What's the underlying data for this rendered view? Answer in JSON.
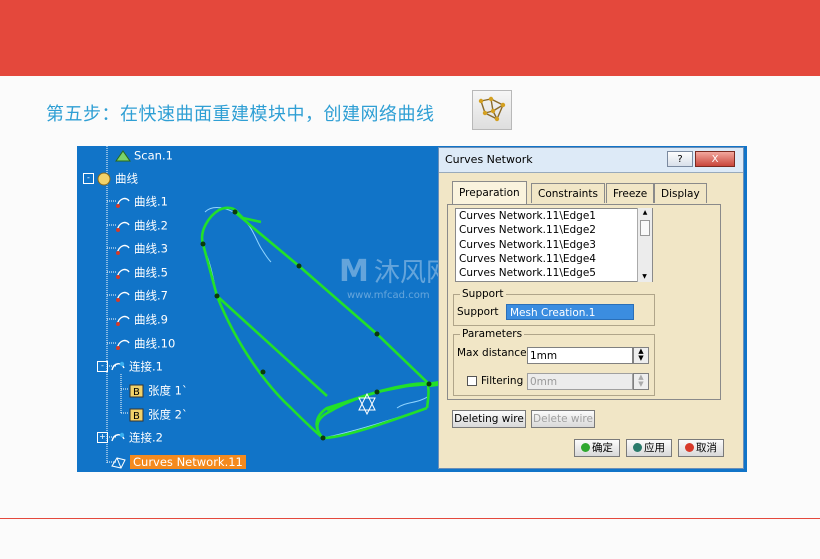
{
  "title": "第五步：在快速曲面重建模块中，创建网络曲线",
  "tree": [
    {
      "label": "Scan.1",
      "icon": "scan-icon"
    },
    {
      "label": "曲线",
      "icon": "geometric-set-icon"
    },
    {
      "label": "曲线.1",
      "icon": "curve-icon"
    },
    {
      "label": "曲线.2",
      "icon": "curve-icon"
    },
    {
      "label": "曲线.3",
      "icon": "curve-icon"
    },
    {
      "label": "曲线.5",
      "icon": "curve-icon"
    },
    {
      "label": "曲线.7",
      "icon": "curve-icon"
    },
    {
      "label": "曲线.9",
      "icon": "curve-icon"
    },
    {
      "label": "曲线.10",
      "icon": "curve-icon"
    },
    {
      "label": "连接.1",
      "icon": "join-icon"
    },
    {
      "label": "张度 1`",
      "icon": "tension-icon"
    },
    {
      "label": "张度 2`",
      "icon": "tension-icon"
    },
    {
      "label": "连接.2",
      "icon": "join-icon"
    },
    {
      "label": "Curves Network.11",
      "icon": "curves-network-icon"
    }
  ],
  "dialog": {
    "title": "Curves Network",
    "help": "?",
    "close": "X",
    "tabs": [
      "Preparation",
      "Constraints",
      "Freeze",
      "Display"
    ],
    "edges": [
      "Curves Network.11\\Edge1",
      "Curves Network.11\\Edge2",
      "Curves Network.11\\Edge3",
      "Curves Network.11\\Edge4",
      "Curves Network.11\\Edge5"
    ],
    "support_group": "Support",
    "support_label": "Support",
    "support_value": "Mesh Creation.1",
    "params_group": "Parameters",
    "max_distance_label": "Max distance",
    "max_distance_value": "1mm",
    "filtering_label": "Filtering",
    "filtering_value": "0mm",
    "deleting_wire": "Deleting wire",
    "delete_wire": "Delete wire",
    "ok": "确定",
    "apply": "应用",
    "cancel": "取消"
  },
  "watermark": {
    "brand": "沐风网",
    "url": "www.mfcad.com"
  },
  "colors": {
    "banner": "#e4483c",
    "title": "#2f9fd4",
    "viewport": "#1174c8",
    "curve": "#22e02a",
    "selection": "#f48a1e"
  }
}
